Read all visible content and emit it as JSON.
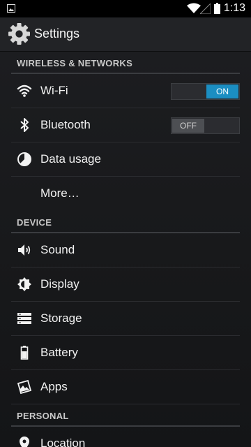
{
  "status_bar": {
    "time": "1:13",
    "icons": [
      "image-notification-icon",
      "wifi-icon",
      "cellular-signal-icon",
      "battery-icon"
    ]
  },
  "action_bar": {
    "title": "Settings",
    "icon": "settings-gear-icon"
  },
  "colors": {
    "accent": "#1b8ec2",
    "background": "#18191b",
    "action_bar": "#222326",
    "divider": "#3a3c40"
  },
  "sections": [
    {
      "title": "WIRELESS & NETWORKS",
      "items": [
        {
          "label": "Wi-Fi",
          "icon": "wifi-icon",
          "toggle": "ON"
        },
        {
          "label": "Bluetooth",
          "icon": "bluetooth-icon",
          "toggle": "OFF"
        },
        {
          "label": "Data usage",
          "icon": "data-usage-icon"
        },
        {
          "label": "More…",
          "icon": ""
        }
      ]
    },
    {
      "title": "DEVICE",
      "items": [
        {
          "label": "Sound",
          "icon": "sound-icon"
        },
        {
          "label": "Display",
          "icon": "display-brightness-icon"
        },
        {
          "label": "Storage",
          "icon": "storage-icon"
        },
        {
          "label": "Battery",
          "icon": "battery-icon"
        },
        {
          "label": "Apps",
          "icon": "apps-icon"
        }
      ]
    },
    {
      "title": "PERSONAL",
      "items": [
        {
          "label": "Location",
          "icon": "location-icon"
        }
      ]
    }
  ]
}
